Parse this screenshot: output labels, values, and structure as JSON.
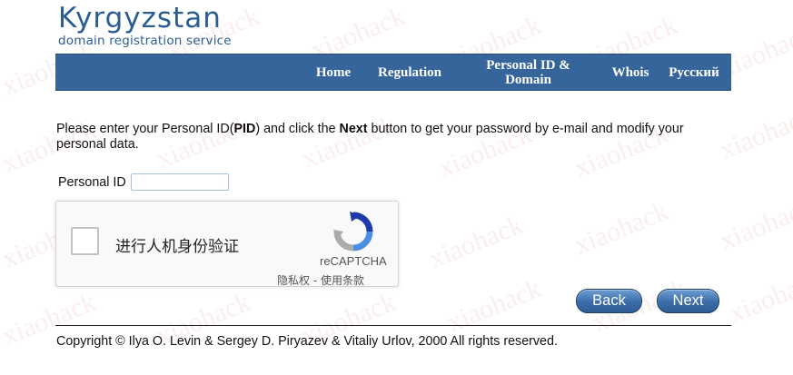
{
  "logo": {
    "title": "Kyrgyzstan",
    "subtitle": "domain registration service"
  },
  "nav": {
    "items": [
      {
        "label": "Home"
      },
      {
        "label": "Regulation"
      },
      {
        "label": "Personal ID & Domain"
      },
      {
        "label": "Whois"
      },
      {
        "label": "Русский"
      }
    ]
  },
  "intro": {
    "text_1": "Please enter your Personal ID(",
    "pid_bold": "PID",
    "text_2": ") and click the ",
    "next_bold": "Next",
    "text_3": " button to get your password by e-mail and modify your personal data."
  },
  "form": {
    "pid_label": "Personal ID",
    "pid_value": ""
  },
  "recaptcha": {
    "label": "进行人机身份验证",
    "brand": "reCAPTCHA",
    "privacy": "隐私权",
    "separator": " - ",
    "terms": "使用条款"
  },
  "buttons": {
    "back": "Back",
    "next": "Next"
  },
  "footer": {
    "copyright": "Copyright © Ilya O. Levin & Sergey D. Piryazev & Vitaliy Urlov, 2000 All rights reserved."
  },
  "watermark": {
    "text": "xiaohack"
  },
  "colors": {
    "navbar": "#36659b",
    "logo": "#2a5d92",
    "button": "#3b6ca8"
  }
}
